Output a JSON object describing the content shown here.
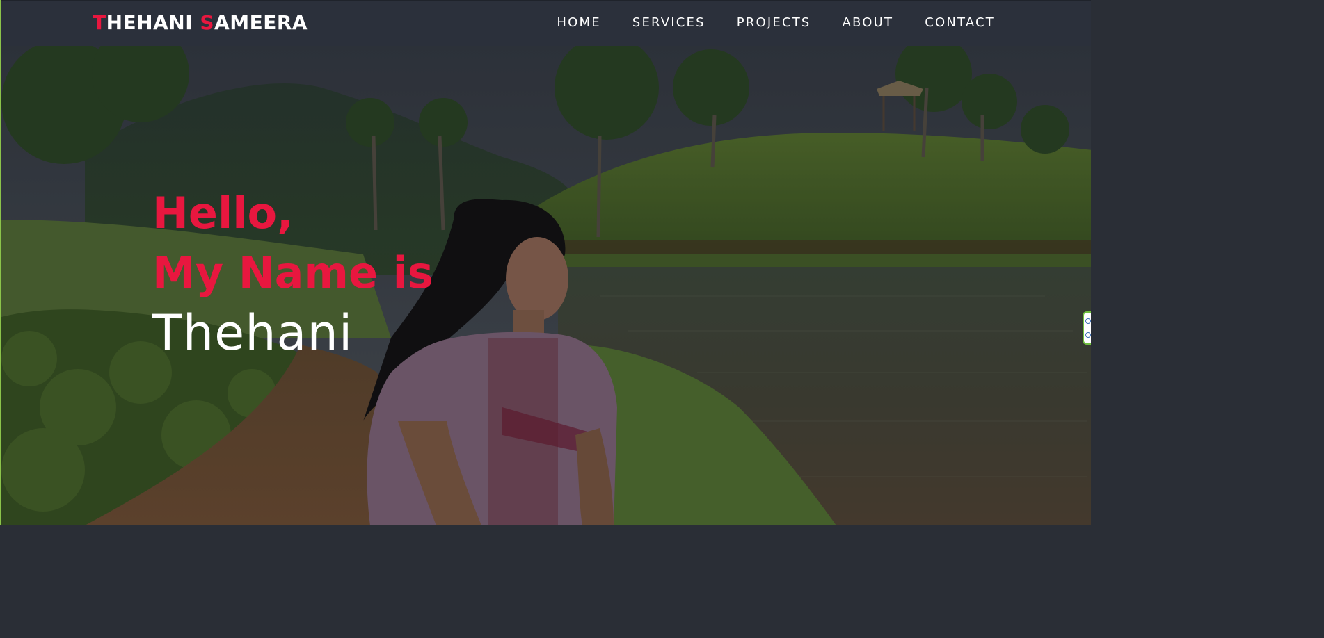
{
  "navbar": {
    "brand": {
      "first_initial": "T",
      "first_rest": "HEHANI ",
      "last_initial": "S",
      "last_rest": "AMEERA"
    },
    "links": [
      {
        "label": "HOME"
      },
      {
        "label": "SERVICES"
      },
      {
        "label": "PROJECTS"
      },
      {
        "label": "ABOUT"
      },
      {
        "label": "CONTACT"
      }
    ]
  },
  "hero": {
    "line1": "Hello,",
    "line2": "My Name is",
    "line3": "Thehani",
    "background_image": "portrait-by-lake-in-tea-estate"
  },
  "colors": {
    "accent": "#e8173f",
    "navbar_bg": "#2b303b",
    "text": "#ffffff"
  }
}
